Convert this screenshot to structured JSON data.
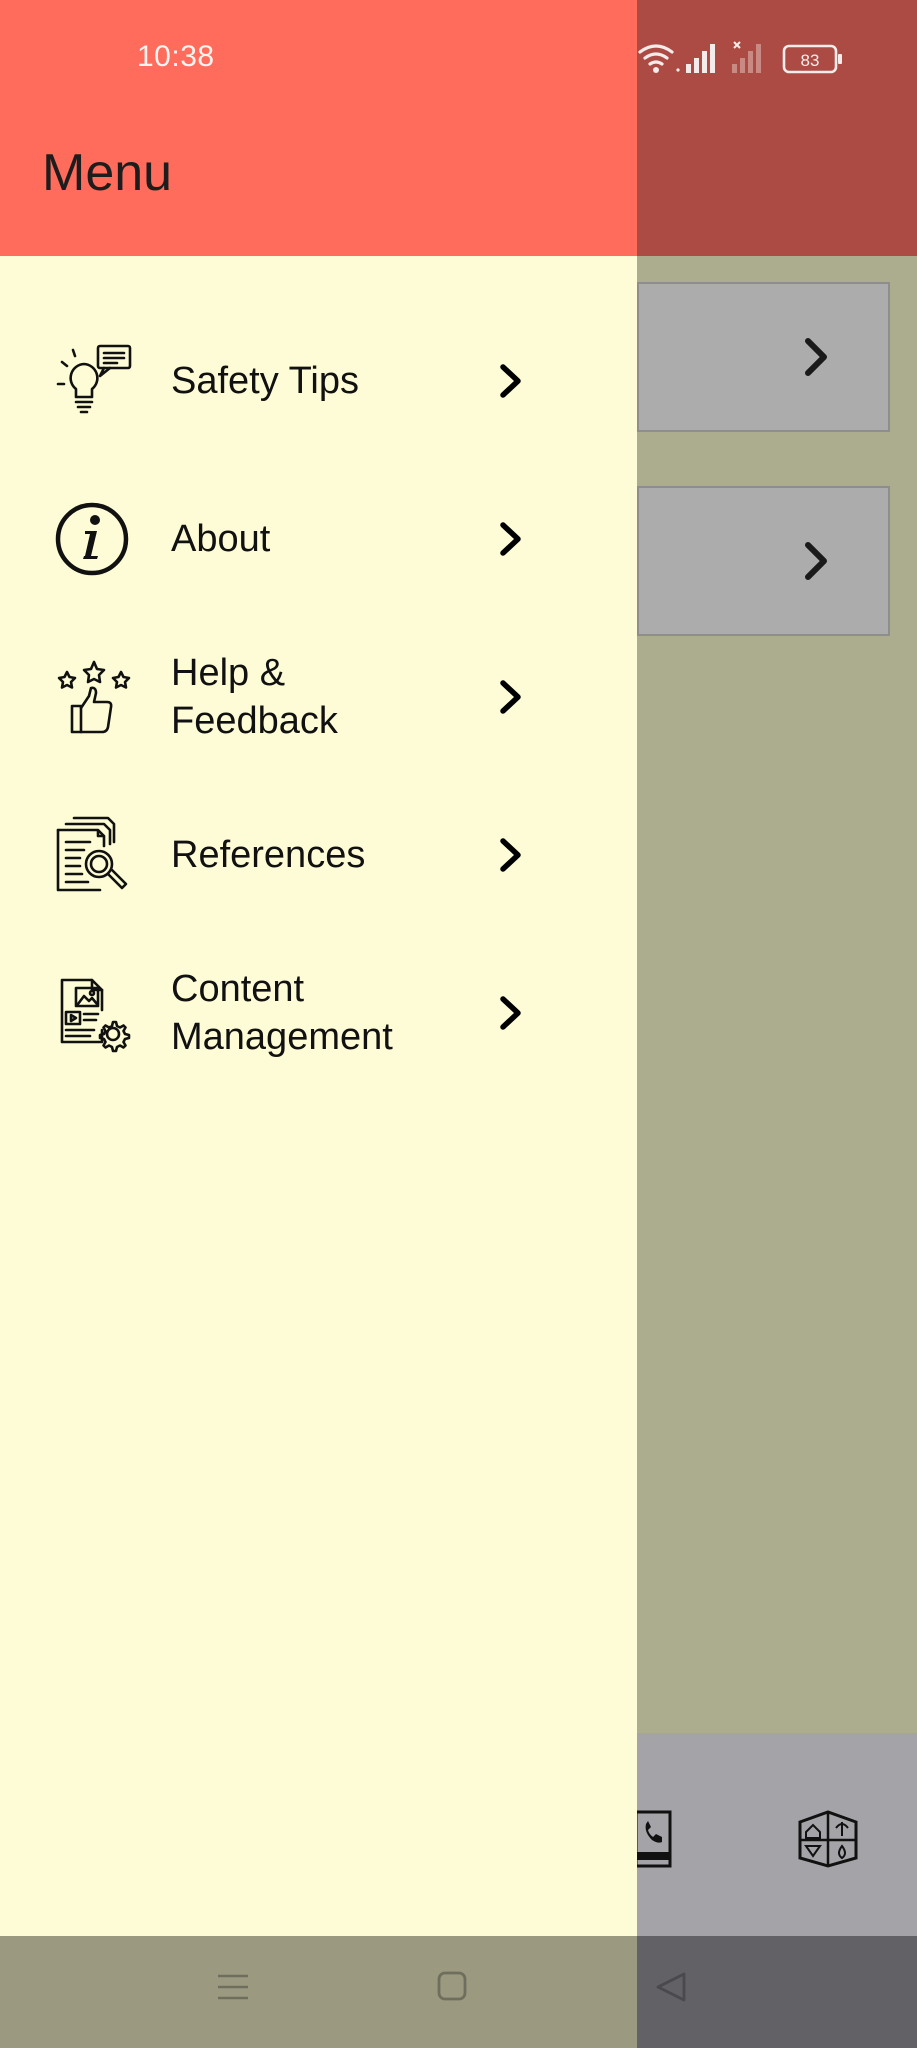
{
  "status_bar": {
    "time": "10:38",
    "battery": "83"
  },
  "drawer": {
    "title": "Menu",
    "items": [
      {
        "label": "Safety Tips",
        "icon": "lightbulb-idea-icon"
      },
      {
        "label": "About",
        "icon": "info-circle-icon"
      },
      {
        "label": "Help &\nFeedback",
        "icon": "thumbs-up-stars-icon"
      },
      {
        "label": "References",
        "icon": "documents-search-icon"
      },
      {
        "label": "Content\nManagement",
        "icon": "document-settings-icon"
      }
    ]
  },
  "background_app": {
    "tabs": [
      {
        "icon": "contact-phone-icon"
      },
      {
        "icon": "hazard-grid-icon"
      }
    ]
  },
  "nav_bar": {
    "buttons": [
      "menu-icon",
      "home-square-icon",
      "back-triangle-icon"
    ]
  },
  "colors": {
    "drawer_header": "#ff6c5c",
    "drawer_body": "#fefcd6",
    "scrim_header": "#ab4b44",
    "scrim_body": "#acac8f"
  }
}
